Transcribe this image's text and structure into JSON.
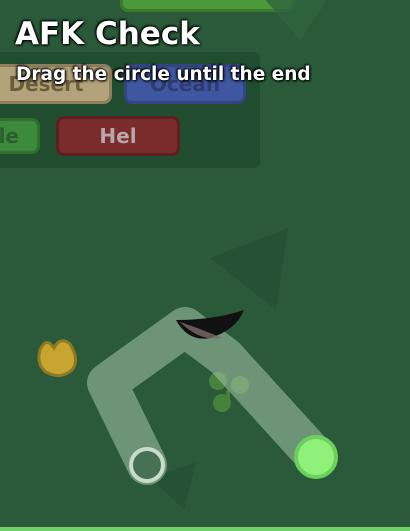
{
  "afk_check": {
    "title": "AFK Check",
    "instruction": "Drag the circle until the end"
  },
  "biome_buttons": [
    {
      "label": "Desert"
    },
    {
      "label": "Ocean"
    },
    {
      "label": "le"
    },
    {
      "label": "Hel"
    }
  ],
  "colors": {
    "background": "#2b5a3a",
    "path_track": "#a6c4aa",
    "handle": "#8ff07a",
    "end_ring": "#c9dccc"
  }
}
